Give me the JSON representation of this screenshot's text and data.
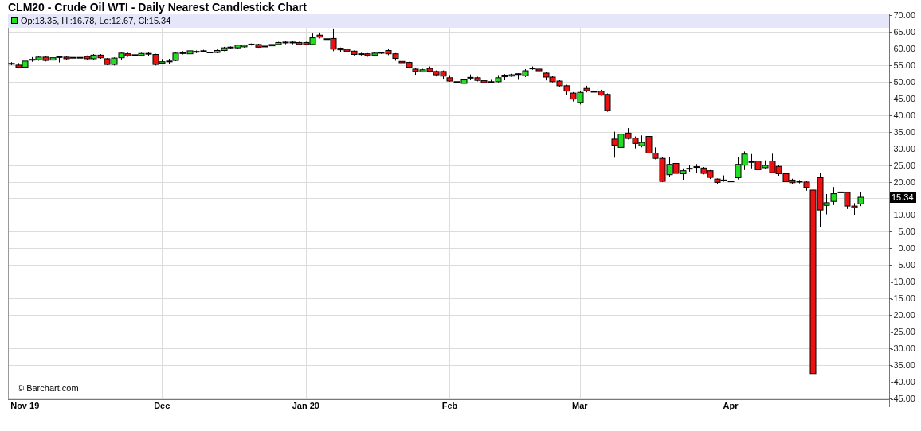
{
  "title": "CLM20 - Crude Oil WTI - Daily Nearest Candlestick Chart",
  "legend": {
    "text": "Op:13.35, Hi:16.78, Lo:12.67, Cl:15.34"
  },
  "price_tag": "15.34",
  "credit": "© Barchart.com",
  "chart_data": {
    "type": "candlestick",
    "grid": true,
    "ylim": [
      -45.3,
      70.5
    ],
    "categories": [
      null,
      null,
      "Nov 19",
      null,
      null,
      null,
      null,
      null,
      null,
      null,
      null,
      null,
      null,
      null,
      null,
      null,
      null,
      null,
      null,
      null,
      null,
      null,
      "Dec",
      null,
      null,
      null,
      null,
      null,
      null,
      null,
      null,
      null,
      null,
      null,
      null,
      null,
      null,
      null,
      null,
      null,
      null,
      null,
      null,
      "Jan 20",
      null,
      null,
      null,
      null,
      null,
      null,
      null,
      null,
      null,
      null,
      null,
      null,
      null,
      null,
      null,
      null,
      null,
      null,
      null,
      null,
      "Feb",
      null,
      null,
      null,
      null,
      null,
      null,
      null,
      null,
      null,
      null,
      null,
      null,
      null,
      null,
      null,
      null,
      null,
      null,
      "Mar",
      null,
      null,
      null,
      null,
      null,
      null,
      null,
      null,
      null,
      null,
      null,
      null,
      null,
      null,
      null,
      null,
      null,
      null,
      null,
      null,
      null,
      "Apr",
      null,
      null,
      null,
      null,
      null,
      null,
      null,
      null,
      null,
      null,
      null,
      null,
      null,
      null,
      null,
      null,
      null,
      null,
      null
    ],
    "yticks": [
      {
        "value": 70,
        "label": "70.00"
      },
      {
        "value": 65,
        "label": "65.00"
      },
      {
        "value": 60,
        "label": "60.00"
      },
      {
        "value": 55,
        "label": "55.00"
      },
      {
        "value": 50,
        "label": "50.00"
      },
      {
        "value": 45,
        "label": "45.00"
      },
      {
        "value": 40,
        "label": "40.00"
      },
      {
        "value": 35,
        "label": "35.00"
      },
      {
        "value": 30,
        "label": "30.00"
      },
      {
        "value": 25,
        "label": "25.00"
      },
      {
        "value": 20,
        "label": "20.00"
      },
      {
        "value": 10,
        "label": "10.00"
      },
      {
        "value": 5,
        "label": "5.00"
      },
      {
        "value": 0,
        "label": "0.00"
      },
      {
        "value": -5,
        "label": "-5.00"
      },
      {
        "value": -10,
        "label": "-10.00"
      },
      {
        "value": -15,
        "label": "-15.00"
      },
      {
        "value": -20,
        "label": "-20.00"
      },
      {
        "value": -25,
        "label": "-25.00"
      },
      {
        "value": -30,
        "label": "-30.00"
      },
      {
        "value": -35,
        "label": "-35.00"
      },
      {
        "value": -40,
        "label": "-40.00"
      },
      {
        "value": -45,
        "label": "-45.00"
      }
    ],
    "ohlc": [
      [
        55.4,
        55.9,
        55.0,
        55.4
      ],
      [
        55.0,
        55.6,
        54.0,
        54.4
      ],
      [
        54.4,
        56.4,
        54.2,
        56.2
      ],
      [
        56.6,
        57.4,
        56.0,
        56.6
      ],
      [
        56.6,
        57.7,
        56.3,
        57.4
      ],
      [
        57.4,
        57.7,
        56.1,
        56.4
      ],
      [
        56.5,
        57.5,
        56.2,
        57.2
      ],
      [
        57.4,
        57.8,
        55.8,
        57.4
      ],
      [
        57.4,
        57.6,
        56.6,
        56.9
      ],
      [
        57.2,
        57.7,
        56.7,
        57.2
      ],
      [
        57.2,
        57.7,
        56.7,
        57.2
      ],
      [
        57.6,
        57.9,
        56.6,
        56.9
      ],
      [
        56.9,
        58.3,
        56.6,
        58.0
      ],
      [
        58.0,
        58.3,
        56.9,
        57.2
      ],
      [
        56.9,
        57.1,
        55.0,
        55.2
      ],
      [
        55.2,
        57.3,
        54.9,
        57.1
      ],
      [
        57.2,
        58.9,
        56.6,
        58.6
      ],
      [
        58.4,
        58.7,
        57.5,
        57.8
      ],
      [
        58.0,
        58.4,
        57.5,
        58.0
      ],
      [
        57.9,
        58.7,
        57.7,
        58.5
      ],
      [
        58.4,
        58.8,
        57.6,
        58.4
      ],
      [
        58.2,
        58.4,
        54.9,
        55.2
      ],
      [
        55.6,
        56.8,
        55.4,
        56.0
      ],
      [
        56.1,
        56.9,
        55.4,
        56.1
      ],
      [
        56.4,
        58.8,
        56.2,
        58.6
      ],
      [
        58.6,
        59.2,
        58.2,
        58.6
      ],
      [
        58.4,
        60.0,
        58.1,
        59.3
      ],
      [
        59.0,
        59.4,
        58.6,
        59.0
      ],
      [
        59.2,
        59.6,
        58.8,
        59.2
      ],
      [
        58.8,
        59.2,
        58.3,
        58.8
      ],
      [
        58.8,
        59.7,
        58.6,
        59.4
      ],
      [
        59.4,
        60.5,
        59.2,
        60.2
      ],
      [
        60.3,
        60.6,
        60.0,
        60.3
      ],
      [
        60.2,
        61.2,
        60.0,
        61.0
      ],
      [
        60.5,
        61.2,
        60.3,
        61.0
      ],
      [
        61.2,
        61.5,
        60.9,
        61.2
      ],
      [
        61.2,
        61.4,
        60.2,
        60.4
      ],
      [
        60.6,
        60.9,
        60.3,
        60.6
      ],
      [
        60.8,
        61.4,
        60.6,
        61.2
      ],
      [
        61.2,
        62.0,
        61.0,
        61.8
      ],
      [
        61.8,
        62.3,
        61.3,
        61.8
      ],
      [
        61.8,
        62.3,
        61.3,
        61.8
      ],
      [
        61.8,
        62.0,
        61.0,
        61.2
      ],
      [
        61.8,
        62.0,
        61.0,
        61.2
      ],
      [
        61.2,
        64.5,
        61.0,
        63.2
      ],
      [
        64.0,
        64.8,
        63.0,
        63.4
      ],
      [
        62.8,
        63.3,
        62.2,
        62.8
      ],
      [
        63.0,
        66.0,
        59.2,
        59.8
      ],
      [
        60.1,
        60.3,
        59.0,
        59.6
      ],
      [
        59.8,
        60.0,
        59.0,
        59.2
      ],
      [
        59.2,
        59.4,
        57.9,
        58.2
      ],
      [
        58.3,
        58.7,
        57.9,
        58.3
      ],
      [
        58.4,
        58.6,
        57.5,
        57.9
      ],
      [
        58.0,
        58.9,
        57.7,
        58.6
      ],
      [
        58.7,
        59.0,
        58.4,
        58.7
      ],
      [
        59.4,
        60.0,
        58.0,
        58.4
      ],
      [
        58.4,
        58.6,
        56.3,
        57.0
      ],
      [
        56.1,
        56.3,
        54.8,
        55.7
      ],
      [
        55.8,
        56.0,
        54.0,
        54.4
      ],
      [
        53.8,
        54.0,
        52.1,
        53.1
      ],
      [
        53.0,
        53.9,
        52.8,
        53.6
      ],
      [
        54.0,
        54.6,
        52.8,
        53.2
      ],
      [
        53.1,
        53.4,
        51.6,
        52.1
      ],
      [
        53.1,
        53.4,
        50.9,
        51.7
      ],
      [
        51.2,
        52.0,
        50.0,
        50.2
      ],
      [
        49.9,
        51.2,
        49.5,
        49.9
      ],
      [
        49.5,
        51.1,
        49.3,
        50.8
      ],
      [
        51.2,
        52.2,
        50.5,
        51.2
      ],
      [
        51.2,
        51.5,
        50.1,
        50.4
      ],
      [
        50.3,
        50.6,
        49.5,
        49.7
      ],
      [
        49.9,
        50.8,
        49.6,
        49.9
      ],
      [
        50.0,
        52.0,
        49.8,
        51.2
      ],
      [
        52.0,
        52.3,
        50.6,
        51.5
      ],
      [
        51.7,
        52.4,
        51.5,
        52.1
      ],
      [
        52.3,
        52.5,
        50.8,
        52.3
      ],
      [
        51.8,
        53.8,
        51.4,
        53.3
      ],
      [
        54.0,
        54.6,
        53.6,
        54.0
      ],
      [
        53.8,
        54.0,
        52.4,
        53.3
      ],
      [
        52.6,
        52.9,
        50.4,
        51.4
      ],
      [
        51.4,
        51.8,
        49.8,
        50.0
      ],
      [
        50.2,
        50.5,
        48.3,
        48.8
      ],
      [
        48.8,
        49.1,
        46.0,
        47.2
      ],
      [
        46.6,
        46.9,
        44.1,
        44.8
      ],
      [
        43.8,
        47.2,
        43.2,
        46.8
      ],
      [
        48.0,
        48.8,
        46.8,
        47.3
      ],
      [
        47.0,
        48.4,
        46.6,
        47.0
      ],
      [
        47.2,
        47.6,
        45.8,
        46.0
      ],
      [
        46.2,
        46.5,
        41.0,
        41.4
      ],
      [
        32.8,
        35.0,
        27.2,
        31.0
      ],
      [
        30.3,
        35.0,
        30.1,
        34.3
      ],
      [
        34.6,
        36.1,
        32.7,
        33.0
      ],
      [
        33.1,
        33.6,
        30.0,
        31.5
      ],
      [
        30.8,
        33.9,
        30.3,
        31.8
      ],
      [
        33.6,
        33.8,
        28.0,
        28.6
      ],
      [
        28.6,
        30.3,
        26.7,
        27.0
      ],
      [
        27.0,
        27.3,
        19.9,
        20.1
      ],
      [
        22.1,
        27.4,
        21.5,
        25.2
      ],
      [
        25.5,
        28.4,
        22.2,
        22.5
      ],
      [
        22.4,
        24.0,
        20.6,
        23.3
      ],
      [
        23.9,
        24.9,
        23.0,
        23.9
      ],
      [
        24.4,
        25.3,
        22.6,
        24.4
      ],
      [
        24.1,
        24.4,
        22.2,
        22.5
      ],
      [
        23.3,
        23.5,
        20.8,
        21.3
      ],
      [
        20.8,
        21.0,
        19.2,
        19.8
      ],
      [
        20.4,
        21.9,
        20.0,
        20.4
      ],
      [
        20.1,
        21.4,
        19.6,
        20.1
      ],
      [
        21.2,
        27.4,
        20.7,
        25.2
      ],
      [
        25.0,
        29.1,
        23.5,
        28.3
      ],
      [
        25.9,
        28.3,
        24.0,
        25.9
      ],
      [
        26.2,
        27.3,
        23.4,
        23.6
      ],
      [
        24.2,
        26.4,
        23.8,
        24.9
      ],
      [
        26.2,
        28.4,
        22.5,
        22.7
      ],
      [
        24.6,
        24.9,
        21.8,
        22.4
      ],
      [
        22.4,
        23.2,
        19.9,
        20.0
      ],
      [
        20.5,
        20.9,
        19.2,
        19.7
      ],
      [
        20.0,
        20.5,
        19.5,
        20.0
      ],
      [
        19.9,
        20.2,
        17.3,
        18.3
      ],
      [
        17.5,
        17.9,
        -40.3,
        -37.6
      ],
      [
        21.2,
        22.6,
        6.5,
        11.5
      ],
      [
        12.9,
        16.3,
        10.2,
        13.7
      ],
      [
        14.1,
        18.4,
        13.0,
        16.4
      ],
      [
        16.8,
        17.8,
        15.6,
        16.8
      ],
      [
        16.8,
        17.0,
        11.8,
        12.7
      ],
      [
        12.7,
        13.6,
        10.0,
        12.2
      ],
      [
        13.35,
        16.78,
        12.67,
        15.34
      ]
    ]
  }
}
